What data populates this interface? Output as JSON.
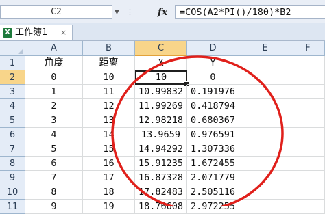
{
  "formula_bar": {
    "name_box": "C2",
    "fx_label": "fx",
    "formula": "=COS(A2*PI()/180)*B2"
  },
  "workbook_tab": {
    "icon": "excel-icon",
    "title": "工作簿1",
    "close": "×"
  },
  "columns": [
    "A",
    "B",
    "C",
    "D",
    "E",
    "F"
  ],
  "rows": [
    {
      "num": "1",
      "cells": [
        "角度",
        "距离",
        "X",
        "Y",
        "",
        ""
      ]
    },
    {
      "num": "2",
      "cells": [
        "0",
        "10",
        "10",
        "0",
        "",
        ""
      ]
    },
    {
      "num": "3",
      "cells": [
        "1",
        "11",
        "10.99832",
        "0.191976",
        "",
        ""
      ]
    },
    {
      "num": "4",
      "cells": [
        "2",
        "12",
        "11.99269",
        "0.418794",
        "",
        ""
      ]
    },
    {
      "num": "5",
      "cells": [
        "3",
        "13",
        "12.98218",
        "0.680367",
        "",
        ""
      ]
    },
    {
      "num": "6",
      "cells": [
        "4",
        "14",
        "13.9659",
        "0.976591",
        "",
        ""
      ]
    },
    {
      "num": "7",
      "cells": [
        "5",
        "15",
        "14.94292",
        "1.307336",
        "",
        ""
      ]
    },
    {
      "num": "8",
      "cells": [
        "6",
        "16",
        "15.91235",
        "1.672455",
        "",
        ""
      ]
    },
    {
      "num": "9",
      "cells": [
        "7",
        "17",
        "16.87328",
        "2.071779",
        "",
        ""
      ]
    },
    {
      "num": "10",
      "cells": [
        "8",
        "18",
        "17.82483",
        "2.505116",
        "",
        ""
      ]
    },
    {
      "num": "11",
      "cells": [
        "9",
        "19",
        "18.76608",
        "2.972255",
        "",
        ""
      ]
    }
  ],
  "selection": {
    "row": "2",
    "column": "C"
  },
  "annotation_color": "#e0201b"
}
